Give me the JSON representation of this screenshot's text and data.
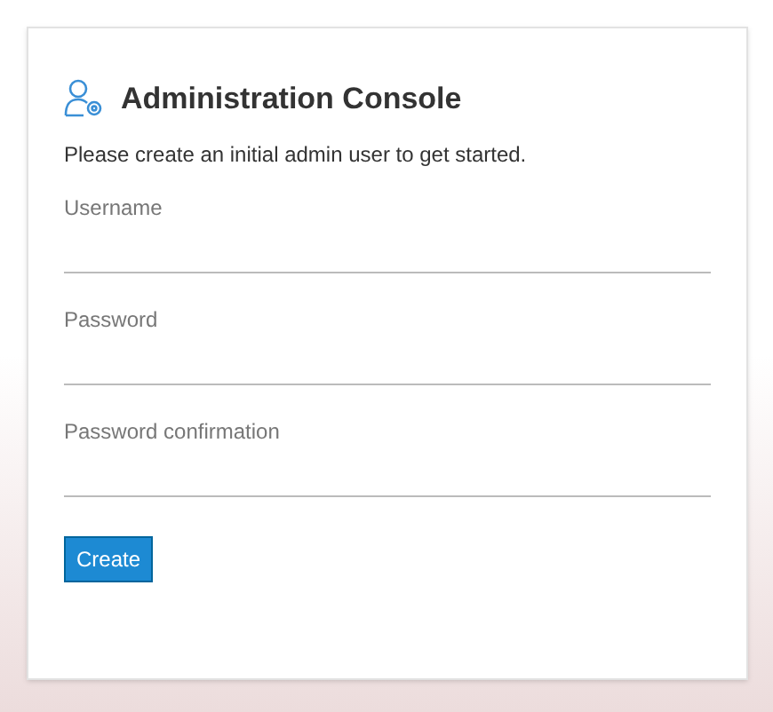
{
  "title": "Administration Console",
  "subtitle": "Please create an initial admin user to get started.",
  "fields": [
    {
      "label": "Username"
    },
    {
      "label": "Password"
    },
    {
      "label": "Password confirmation"
    }
  ],
  "button": "Create"
}
